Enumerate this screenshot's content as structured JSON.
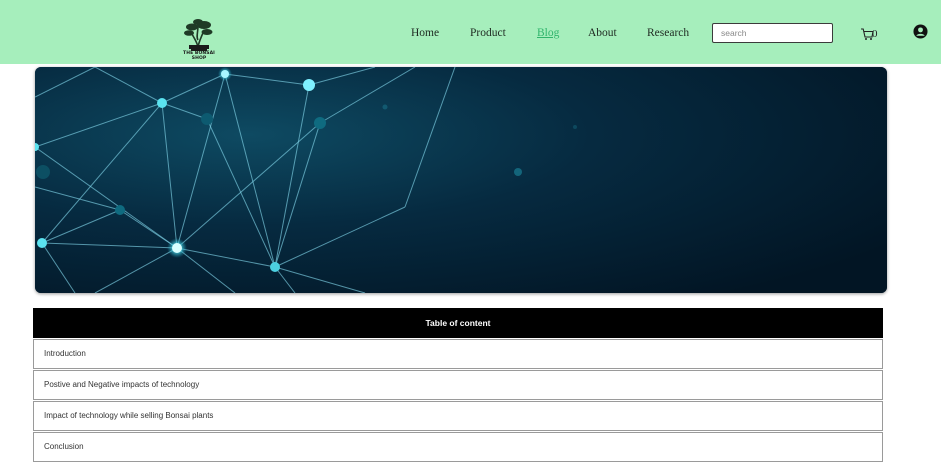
{
  "brand": {
    "logo_text": "THE BONSAI SHOP"
  },
  "nav": {
    "items": [
      {
        "label": "Home",
        "active": false
      },
      {
        "label": "Product",
        "active": false
      },
      {
        "label": "Blog",
        "active": true
      },
      {
        "label": "About",
        "active": false
      },
      {
        "label": "Research",
        "active": false
      }
    ]
  },
  "search": {
    "placeholder": "search",
    "value": ""
  },
  "cart": {
    "icon": "cart-icon",
    "count": "0"
  },
  "account": {
    "icon": "user-icon"
  },
  "banner": {
    "image": "network-technology-banner"
  },
  "toc": {
    "title": "Table of content",
    "items": [
      "Introduction",
      "Postive and Negative impacts of technology",
      "Impact of technology while selling Bonsai plants",
      "Conclusion"
    ]
  },
  "colors": {
    "header_bg": "#a6eebc",
    "active_link": "#2fb46b",
    "toc_header_bg": "#000000",
    "banner_bg": "#06253a"
  }
}
